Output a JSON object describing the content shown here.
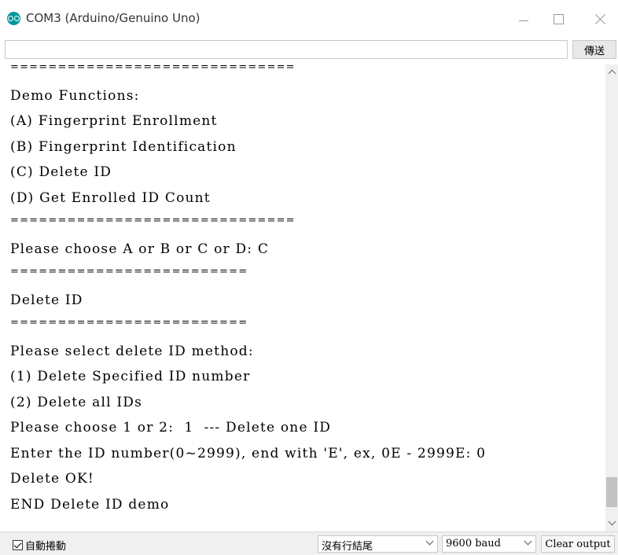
{
  "window": {
    "title": "COM3 (Arduino/Genuino Uno)"
  },
  "send_row": {
    "input_value": "",
    "send_label": "傳送"
  },
  "output": {
    "lines": [
      "==============================",
      "Demo Functions:",
      "(A) Fingerprint Enrollment",
      "(B) Fingerprint Identification",
      "(C) Delete ID",
      "(D) Get Enrolled ID Count",
      "==============================",
      "Please choose A or B or C or D: C",
      "=========================",
      "Delete ID",
      "=========================",
      "Please select delete ID method:",
      "(1) Delete Specified ID number",
      "(2) Delete all IDs",
      "Please choose 1 or 2:  1  --- Delete one ID",
      "Enter the ID number(0~2999), end with 'E', ex, 0E - 2999E: 0",
      "Delete OK!",
      "END Delete ID demo"
    ]
  },
  "status_bar": {
    "autoscroll_checked": true,
    "autoscroll_label": "自動捲動",
    "line_ending": "沒有行結尾",
    "baud_rate": "9600 baud",
    "clear_label": "Clear output"
  },
  "colors": {
    "arduino_teal": "#00979c",
    "status_bar_bg": "#f0f0f0",
    "scroll_thumb": "#c2c2c2"
  },
  "icons": [
    "arduino-logo-icon",
    "minimize-icon",
    "maximize-icon",
    "close-icon",
    "scroll-up-arrow-icon",
    "scroll-down-arrow-icon",
    "checkbox-checked-icon",
    "chevron-down-icon"
  ]
}
